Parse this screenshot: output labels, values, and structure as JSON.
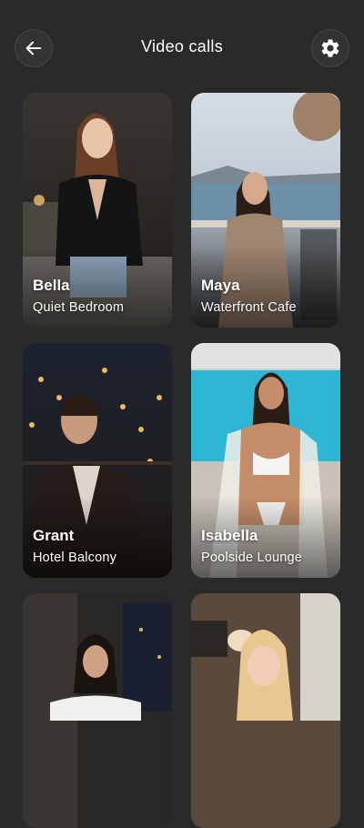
{
  "header": {
    "title": "Video calls",
    "back_icon": "arrow-left-icon",
    "settings_icon": "gear-icon"
  },
  "cards": [
    {
      "name": "Bella",
      "place": "Quiet Bedroom"
    },
    {
      "name": "Maya",
      "place": "Waterfront Cafe"
    },
    {
      "name": "Grant",
      "place": "Hotel Balcony"
    },
    {
      "name": "Isabella",
      "place": "Poolside Lounge"
    },
    {
      "name": "",
      "place": ""
    },
    {
      "name": "",
      "place": ""
    }
  ],
  "colors": {
    "background": "#2a2a2a",
    "button_bg": "#333333",
    "text": "#ffffff"
  }
}
